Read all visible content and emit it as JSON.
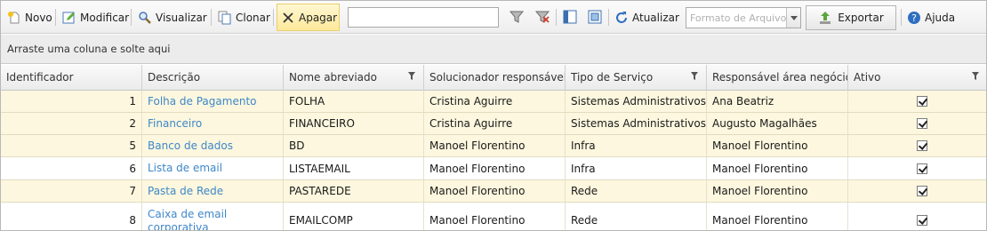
{
  "toolbar": {
    "novo": "Novo",
    "modificar": "Modificar",
    "visualizar": "Visualizar",
    "clonar": "Clonar",
    "apagar": "Apagar",
    "search_value": "",
    "atualizar": "Atualizar",
    "formato_placeholder": "Formato de Arquivo",
    "exportar": "Exportar",
    "ajuda": "Ajuda"
  },
  "group_hint": "Arraste uma coluna e solte aqui",
  "columns": [
    "Identificador",
    "Descrição",
    "Nome abreviado",
    "Solucionador responsável",
    "Tipo de Serviço",
    "Responsável área negócio",
    "Ativo"
  ],
  "rows": [
    {
      "id": "1",
      "descricao": "Folha de Pagamento",
      "nome": "FOLHA",
      "solucionador": "Cristina Aguirre",
      "tipo": "Sistemas Administrativos",
      "responsavel": "Ana Beatriz",
      "ativo": true
    },
    {
      "id": "2",
      "descricao": "Financeiro",
      "nome": "FINANCEIRO",
      "solucionador": "Cristina Aguirre",
      "tipo": "Sistemas Administrativos",
      "responsavel": "Augusto Magalhães",
      "ativo": true
    },
    {
      "id": "5",
      "descricao": "Banco de dados",
      "nome": "BD",
      "solucionador": "Manoel Florentino",
      "tipo": "Infra",
      "responsavel": "Manoel Florentino",
      "ativo": true
    },
    {
      "id": "6",
      "descricao": "Lista de email",
      "nome": "LISTAEMAIL",
      "solucionador": "Manoel Florentino",
      "tipo": "Infra",
      "responsavel": "Manoel Florentino",
      "ativo": true
    },
    {
      "id": "7",
      "descricao": "Pasta de Rede",
      "nome": "PASTAREDE",
      "solucionador": "Manoel Florentino",
      "tipo": "Rede",
      "responsavel": "Manoel Florentino",
      "ativo": true
    },
    {
      "id": "8",
      "descricao": "Caixa de email corporativa",
      "nome": "EMAILCOMP",
      "solucionador": "Manoel Florentino",
      "tipo": "Rede",
      "responsavel": "Manoel Florentino",
      "ativo": true
    }
  ],
  "colors": {
    "link": "#3f87c9",
    "row_highlight": "#fcf7de",
    "active_button": "#fde99a"
  }
}
